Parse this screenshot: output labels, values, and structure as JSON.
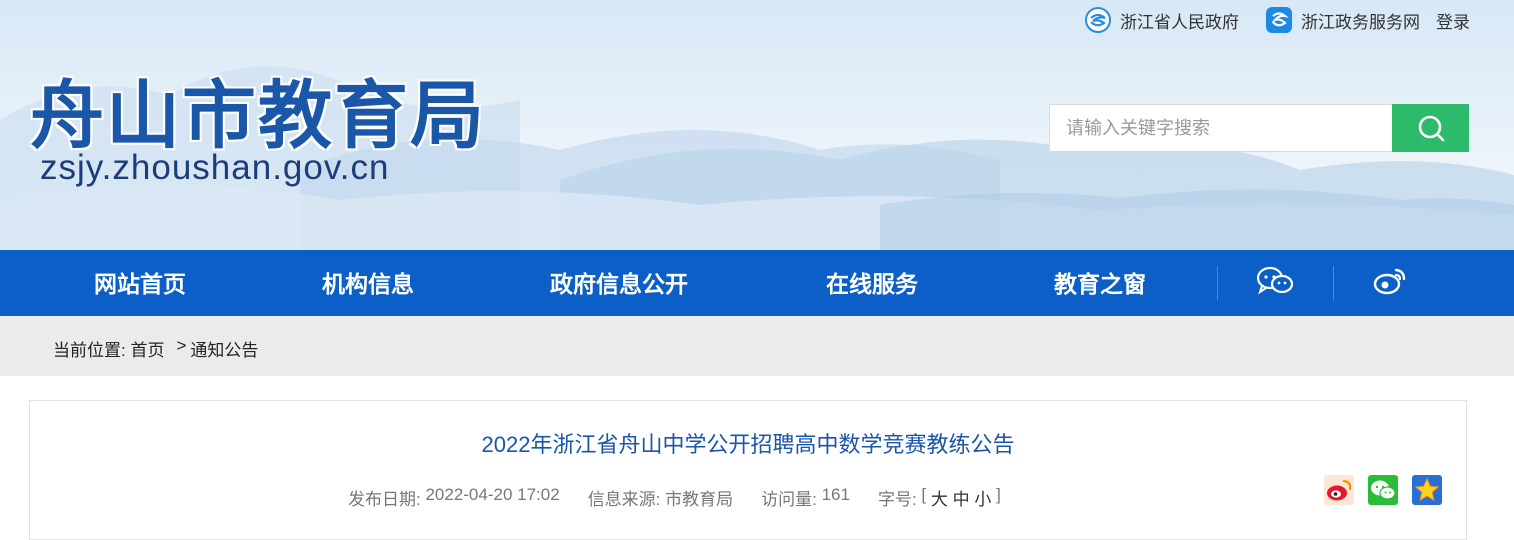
{
  "header": {
    "top_links": {
      "gov_link": "浙江省人民政府",
      "service_link": "浙江政务服务网",
      "login": "登录"
    },
    "logo_title": "舟山市教育局",
    "logo_url": "zsjy.zhoushan.gov.cn",
    "search": {
      "placeholder": "请输入关键字搜索",
      "value": ""
    }
  },
  "nav": {
    "items": [
      "网站首页",
      "机构信息",
      "政府信息公开",
      "在线服务",
      "教育之窗"
    ],
    "social_icons": [
      "wechat-icon",
      "weibo-icon"
    ]
  },
  "breadcrumb": {
    "prefix": "当前位置: ",
    "home": "首页",
    "separator": ">",
    "current": "通知公告"
  },
  "article": {
    "title": "2022年浙江省舟山中学公开招聘高中数学竞赛教练公告",
    "meta": {
      "date_label": "发布日期: ",
      "date": "2022-04-20 17:02",
      "source_label": "信息来源: ",
      "source": "市教育局",
      "views_label": "访问量: ",
      "views": "161",
      "fontsize_label": "字号: ",
      "bracket_open": "[ ",
      "size_large": "大",
      "size_medium": "中",
      "size_small": "小",
      "bracket_close": " ]"
    },
    "share_icons": [
      "weibo-share-icon",
      "wechat-share-icon",
      "favorite-star-icon"
    ]
  },
  "colors": {
    "nav_bg": "#0b5fc6",
    "search_button": "#2dbb6b",
    "title_blue": "#1a56a8",
    "breadcrumb_bg": "#ebebeb"
  }
}
